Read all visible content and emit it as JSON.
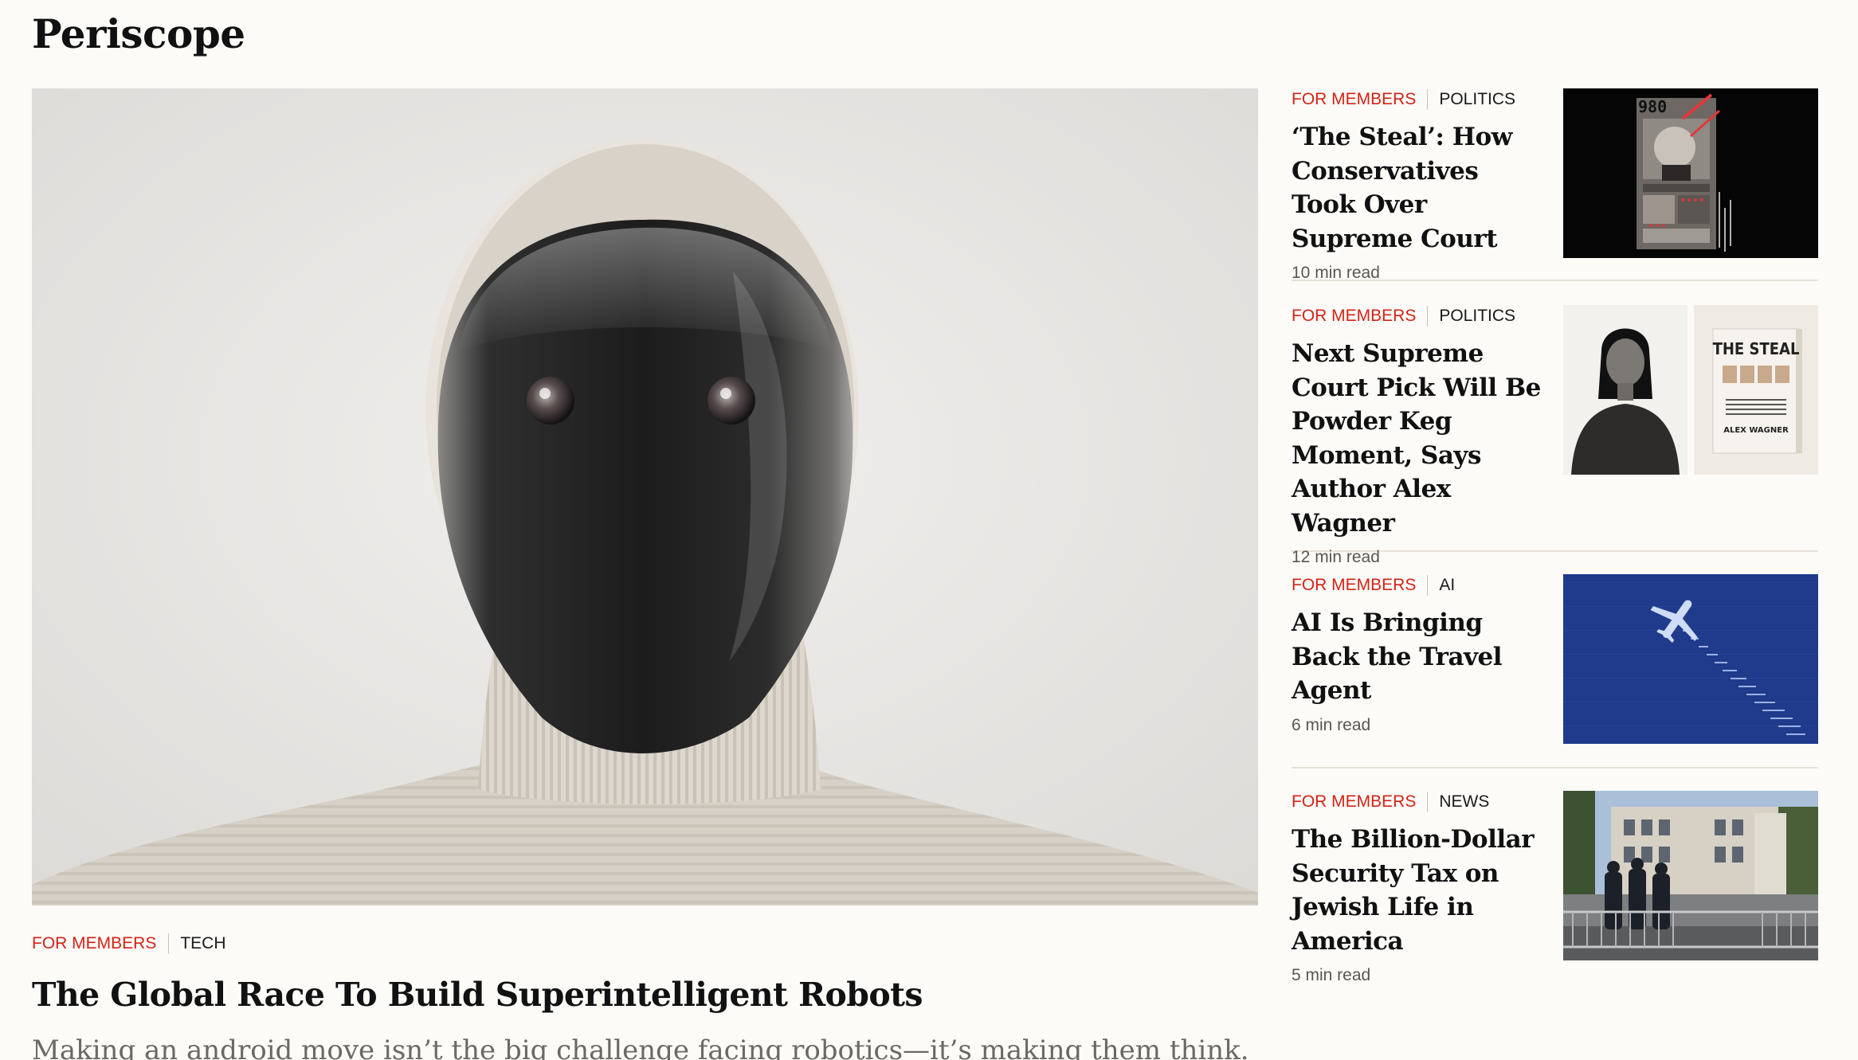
{
  "section": {
    "title": "Periscope"
  },
  "hero": {
    "tag_members": "FOR MEMBERS",
    "tag_topic": "TECH",
    "headline": "The Global Race To Build Superintelligent Robots",
    "dek": "Making an android move isn’t the big challenge facing robotics—it’s making them think."
  },
  "stories": [
    {
      "tag_members": "FOR MEMBERS",
      "tag_topic": "POLITICS",
      "headline": "‘The Steal’: How Conservatives Took Over Supreme Court",
      "read_time": "10 min read",
      "thumb_text": "980"
    },
    {
      "tag_members": "FOR MEMBERS",
      "tag_topic": "POLITICS",
      "headline": "Next Supreme Court Pick Will Be Powder Keg Moment, Says Author Alex Wagner",
      "read_time": "12 min read",
      "book_title": "THE STEAL",
      "book_author": "ALEX WAGNER"
    },
    {
      "tag_members": "FOR MEMBERS",
      "tag_topic": "AI",
      "headline": "AI Is Bringing Back the Travel Agent",
      "read_time": "6 min read"
    },
    {
      "tag_members": "FOR MEMBERS",
      "tag_topic": "NEWS",
      "headline": "The Billion-Dollar Security Tax on Jewish Life in America",
      "read_time": "5 min read"
    }
  ],
  "colors": {
    "page_background": "#fcfbf8",
    "members_tag": "#d32316",
    "divider": "#e7e1d8",
    "dek_text": "#6c6864"
  }
}
